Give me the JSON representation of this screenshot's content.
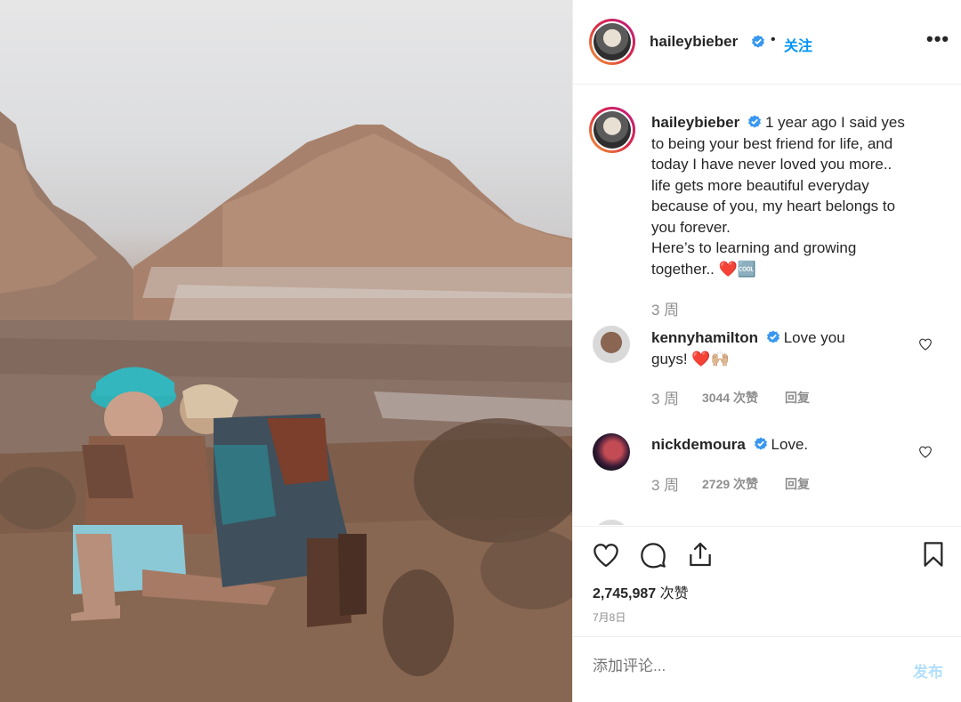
{
  "post": {
    "username": "haileybieber",
    "follow_label": "关注",
    "more_label": "•••"
  },
  "caption": {
    "username": "haileybieber",
    "lines": [
      "1 year ago I said yes",
      "to being your best friend for life, and",
      "today I have never loved you more..",
      "life gets more beautiful everyday",
      "because of you, my heart belongs to",
      "you forever.",
      "Here’s to learning and growing",
      "together.. ❤️🆒"
    ],
    "time": "3 周"
  },
  "comments": [
    {
      "username": "kennyhamilton",
      "text_line1": "Love you",
      "text_line2": "guys! ❤️🙌🏼",
      "time": "3 周",
      "likes": "3044 次赞",
      "reply": "回复"
    },
    {
      "username": "nickdemoura",
      "text_line1": "Love.",
      "time": "3 周",
      "likes": "2729 次赞",
      "reply": "回复"
    }
  ],
  "stats": {
    "likes_count": "2,745,987",
    "likes_label": "次赞",
    "date": "7月8日"
  },
  "comment_box": {
    "placeholder": "添加评论...",
    "post_label": "发布"
  },
  "icons": {
    "verified": "verified-badge-icon",
    "like": "heart-icon",
    "comment": "comment-bubble-icon",
    "share": "share-icon",
    "save": "bookmark-icon"
  },
  "colors": {
    "accent": "#0095f6",
    "verified": "#3897f0",
    "muted": "#8e8e8e",
    "post_disabled": "#b2dffc"
  }
}
